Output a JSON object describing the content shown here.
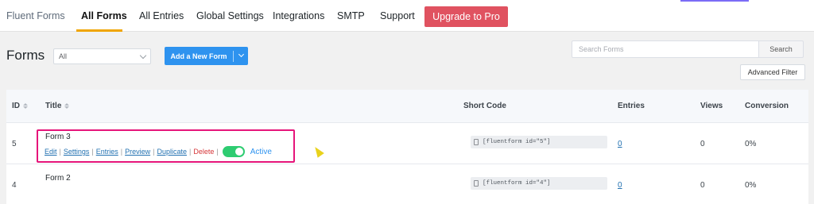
{
  "nav": {
    "brand": "Fluent Forms",
    "items": [
      "All Forms",
      "All Entries",
      "Global Settings",
      "Integrations",
      "SMTP",
      "Support"
    ],
    "upgrade": "Upgrade to Pro"
  },
  "toolbar": {
    "title": "Forms",
    "filter_value": "All",
    "add_button": "Add a New Form",
    "search_placeholder": "Search Forms",
    "search_button": "Search",
    "advanced_filter": "Advanced Filter"
  },
  "table": {
    "headers": {
      "id": "ID",
      "title": "Title",
      "shortcode": "Short Code",
      "entries": "Entries",
      "views": "Views",
      "conversion": "Conversion"
    },
    "rows": [
      {
        "id": "5",
        "title": "Form 3",
        "shortcode": "[fluentform id=\"5\"]",
        "entries": "0",
        "views": "0",
        "conversion": "0%"
      },
      {
        "id": "4",
        "title": "Form 2",
        "shortcode": "[fluentform id=\"4\"]",
        "entries": "0",
        "views": "0",
        "conversion": "0%"
      }
    ],
    "row_actions": {
      "edit": "Edit",
      "settings": "Settings",
      "entries": "Entries",
      "preview": "Preview",
      "duplicate": "Duplicate",
      "delete": "Delete",
      "status": "Active"
    }
  },
  "colors": {
    "accent": "#2e93ef",
    "upgrade": "#e05260",
    "toggle_on": "#2ecc71",
    "highlight": "#e6157a",
    "nav_underline": "#f0a500"
  }
}
